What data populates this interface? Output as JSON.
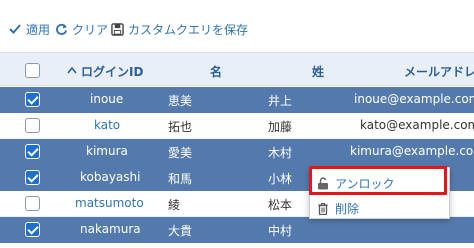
{
  "toolbar": {
    "apply": {
      "label": "適用",
      "icon": "check-icon"
    },
    "clear": {
      "label": "クリア",
      "icon": "refresh-icon"
    },
    "save": {
      "label": "カスタムクエリを保存",
      "icon": "save-icon"
    }
  },
  "table": {
    "columns": [
      "ログインID",
      "名",
      "姓",
      "メールアドレス"
    ],
    "sort_indicator": "^",
    "rows": [
      {
        "login": "inoue",
        "first": "恵美",
        "last": "井上",
        "email": "inoue@example.com",
        "checked": true
      },
      {
        "login": "kato",
        "first": "拓也",
        "last": "加藤",
        "email": "kato@example.com",
        "checked": false
      },
      {
        "login": "kimura",
        "first": "愛美",
        "last": "木村",
        "email": "kimura@example.com",
        "checked": true
      },
      {
        "login": "kobayashi",
        "first": "和馬",
        "last": "小林",
        "email": "",
        "checked": true
      },
      {
        "login": "matsumoto",
        "first": "綾",
        "last": "松本",
        "email": "",
        "checked": false
      },
      {
        "login": "nakamura",
        "first": "大貴",
        "last": "中村",
        "email": "",
        "checked": true
      }
    ]
  },
  "context_menu": {
    "unlock": {
      "label": "アンロック",
      "icon": "unlock-icon"
    },
    "delete": {
      "label": "削除",
      "icon": "trash-icon"
    }
  },
  "colors": {
    "accent": "#2f74b5",
    "selected_row": "#547aad",
    "highlight": "#e3161b"
  }
}
